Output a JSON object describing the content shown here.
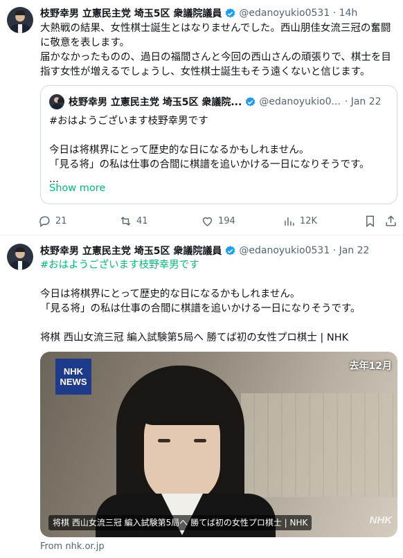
{
  "tweet1": {
    "name": "枝野幸男 立憲民主党 埼玉5区 衆議院議員",
    "handle": "@edanoyukio0531 · 14h",
    "text": "大熱戦の結果、女性棋士誕生とはなりませんでした。西山朋佳女流三冠の奮闘に敬意を表します。\n届かなかったものの、過日の福間さんと今回の西山さんの頑張りで、棋士を目指す女性が増えるでしょうし、女性棋士誕生もそう遠くないと信じます。",
    "quote": {
      "name": "枝野幸男 立憲民主党 埼玉5区 衆議院...",
      "handle": "@edanoyukio0...",
      "date": "· Jan 22",
      "text": "#おはようございます枝野幸男です\n\n今日は将棋界にとって歴史的な日になるかもしれません。\n「見る将」の私は仕事の合間に棋譜を追いかける一日になりそうです。\n...",
      "show_more": "Show more"
    },
    "actions": {
      "replies": "21",
      "reposts": "41",
      "likes": "194",
      "views": "12K"
    }
  },
  "tweet2": {
    "name": "枝野幸男 立憲民主党 埼玉5区 衆議院議員",
    "handle": "@edanoyukio0531 · Jan 22",
    "hashtag": "#おはようございます枝野幸男です",
    "text": "今日は将棋界にとって歴史的な日になるかもしれません。\n「見る将」の私は仕事の合間に棋譜を追いかける一日になりそうです。\n\n将棋 西山女流三冠 編入試験第5局へ 勝てば初の女性プロ棋士 | NHK",
    "card": {
      "logo_line1": "NHK",
      "logo_line2": "NEWS",
      "date_overlay": "去年12月",
      "watermark": "NHK",
      "caption": "将棋 西山女流三冠 編入試験第5局へ 勝てば初の女性プロ棋士 | NHK"
    },
    "source": "From nhk.or.jp"
  },
  "colors": {
    "accent": "#1d9bf0",
    "link_green": "#00ba7c",
    "muted": "#536471"
  }
}
